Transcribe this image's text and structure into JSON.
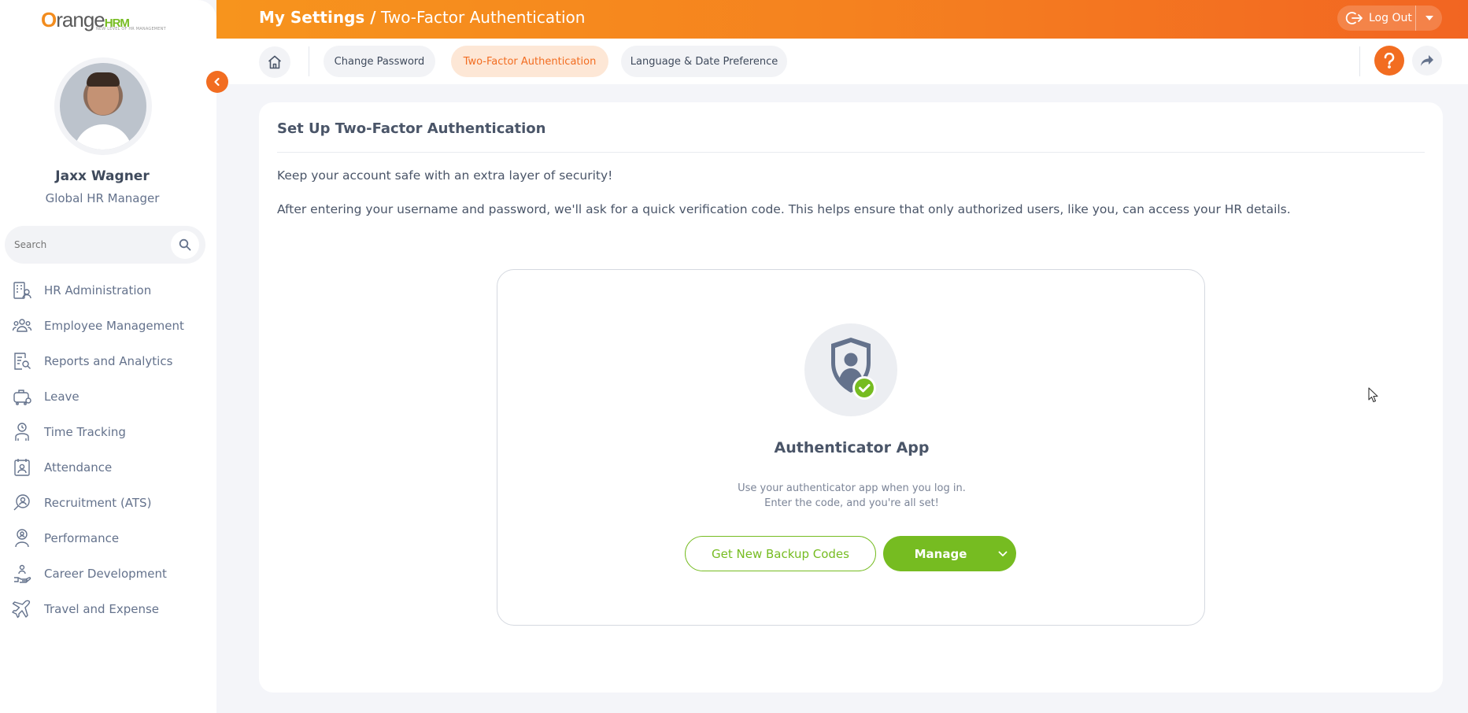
{
  "brand": {
    "logo_o": "O",
    "logo_main": "range",
    "logo_hrm": "HRM",
    "logo_tagline": "NEW LEVEL OF HR MANAGEMENT"
  },
  "user": {
    "name": "Jaxx Wagner",
    "role": "Global HR Manager"
  },
  "sidebar": {
    "search_placeholder": "Search",
    "items": [
      {
        "label": "HR Administration",
        "icon": "building-user-icon"
      },
      {
        "label": "Employee Management",
        "icon": "users-group-icon"
      },
      {
        "label": "Reports and Analytics",
        "icon": "report-search-icon"
      },
      {
        "label": "Leave",
        "icon": "luggage-icon"
      },
      {
        "label": "Time Tracking",
        "icon": "clock-person-icon"
      },
      {
        "label": "Attendance",
        "icon": "calendar-user-icon"
      },
      {
        "label": "Recruitment (ATS)",
        "icon": "search-person-icon"
      },
      {
        "label": "Performance",
        "icon": "award-person-icon"
      },
      {
        "label": "Career Development",
        "icon": "growth-hand-icon"
      },
      {
        "label": "Travel and Expense",
        "icon": "plane-icon"
      }
    ]
  },
  "header": {
    "title_prefix": "My Settings /",
    "title_page": "Two-Factor Authentication",
    "logout_label": "Log Out"
  },
  "tabs": [
    {
      "label": "Change Password",
      "active": false
    },
    {
      "label": "Two-Factor Authentication",
      "active": true
    },
    {
      "label": "Language & Date Preference",
      "active": false
    }
  ],
  "main": {
    "card_title": "Set Up Two-Factor Authentication",
    "intro": "Keep your account safe with an extra layer of security!",
    "explanation": "After entering your username and password, we'll ask for a quick verification code. This helps ensure that only authorized users, like you, can access your HR details.",
    "auth": {
      "title": "Authenticator App",
      "desc_line1": "Use your authenticator app when you log in.",
      "desc_line2": "Enter the code, and you're all set!",
      "backup_button": "Get New Backup Codes",
      "manage_button": "Manage"
    }
  },
  "colors": {
    "accent": "#f26d21",
    "green": "#76bc21",
    "text": "#64728c"
  }
}
